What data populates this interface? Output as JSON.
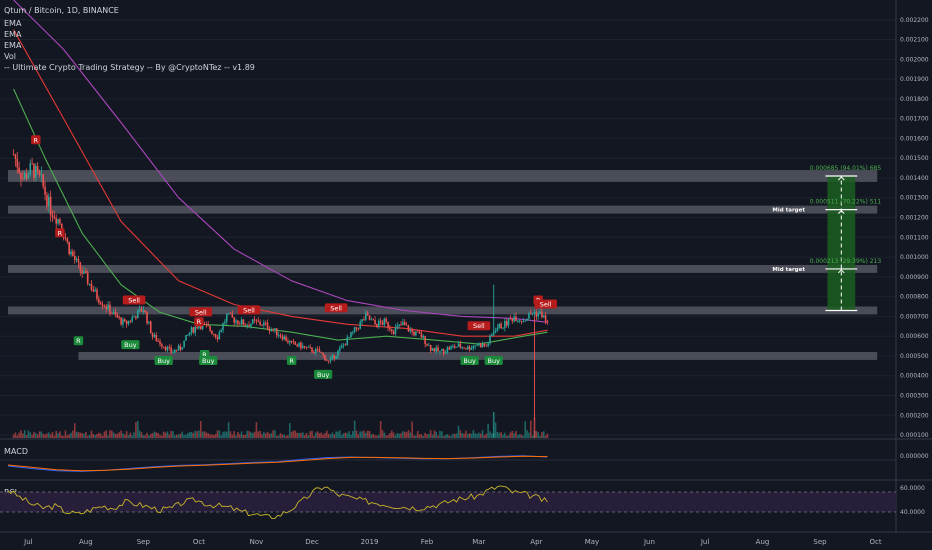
{
  "header": {
    "symbol": "Qtum / Bitcoin, 1D, BINANCE",
    "indicators": [
      "EMA",
      "EMA",
      "EMA",
      "Vol",
      "-- Ultimate Crypto Trading Strategy -- By @CryptoNTez -- v1.89"
    ]
  },
  "colors": {
    "background": "#131722",
    "up": "#26a69a",
    "down": "#ef5350",
    "ema_fast": "#4caf50",
    "ema_mid": "#e53935",
    "ema_slow": "#ab47bc",
    "zone": "#5d606b",
    "target_box": "#1b5e20",
    "rsi_line": "#c9b52a",
    "rsi_band": "#2a1f3d",
    "macd_line": "#2962ff",
    "signal_line": "#ff6d00"
  },
  "chart_data": {
    "type": "candlestick",
    "title": "Qtum / Bitcoin, 1D, BINANCE",
    "ylim": [
      8e-05,
      0.0023
    ],
    "y_ticks": [
      0.0001,
      0.0002,
      0.0003,
      0.0004,
      0.0005,
      0.0006,
      0.0007,
      0.0008,
      0.0009,
      0.001,
      0.0011,
      0.0012,
      0.0013,
      0.0014,
      0.0015,
      0.0016,
      0.0017,
      0.0018,
      0.0019,
      0.002,
      0.0021,
      0.0022
    ],
    "y_tick_labels": [
      "0.000100",
      "0.000200",
      "0.000300",
      "0.000400",
      "0.000500",
      "0.000600",
      "0.000700",
      "0.000800",
      "0.000900",
      "0.001000",
      "0.001100",
      "0.001200",
      "0.001300",
      "0.001400",
      "0.001500",
      "0.001600",
      "0.001700",
      "0.001800",
      "0.001900",
      "0.002000",
      "0.002100",
      "0.002200"
    ],
    "x_labels": [
      "Jul",
      "Aug",
      "Sep",
      "Oct",
      "Nov",
      "Dec",
      "2019",
      "Feb",
      "Mar",
      "Apr",
      "May",
      "Jun",
      "Jul",
      "Aug",
      "Sep",
      "Oct"
    ],
    "price_series": {
      "name": "close",
      "dates": [
        "2018-06-23",
        "2018-06-28",
        "2018-07-03",
        "2018-07-08",
        "2018-07-13",
        "2018-07-18",
        "2018-07-23",
        "2018-07-28",
        "2018-08-02",
        "2018-08-07",
        "2018-08-12",
        "2018-08-17",
        "2018-08-22",
        "2018-08-27",
        "2018-09-01",
        "2018-09-06",
        "2018-09-11",
        "2018-09-16",
        "2018-09-21",
        "2018-09-26",
        "2018-10-01",
        "2018-10-06",
        "2018-10-11",
        "2018-10-16",
        "2018-10-21",
        "2018-10-26",
        "2018-10-31",
        "2018-11-05",
        "2018-11-10",
        "2018-11-15",
        "2018-11-20",
        "2018-11-25",
        "2018-11-30",
        "2018-12-05",
        "2018-12-10",
        "2018-12-15",
        "2018-12-20",
        "2018-12-25",
        "2018-12-30",
        "2019-01-04",
        "2019-01-09",
        "2019-01-14",
        "2019-01-19",
        "2019-01-24",
        "2019-01-29",
        "2019-02-03",
        "2019-02-08",
        "2019-02-13",
        "2019-02-18",
        "2019-02-23",
        "2019-02-28",
        "2019-03-05",
        "2019-03-10",
        "2019-03-15",
        "2019-03-20",
        "2019-03-25",
        "2019-03-30",
        "2019-04-04",
        "2019-04-07"
      ],
      "values": [
        0.00152,
        0.0014,
        0.00145,
        0.00138,
        0.00124,
        0.00118,
        0.00104,
        0.00095,
        0.00088,
        0.0008,
        0.00075,
        0.0007,
        0.00066,
        0.0007,
        0.00074,
        0.0006,
        0.00056,
        0.00052,
        0.00054,
        0.00062,
        0.00066,
        0.00064,
        0.0006,
        0.0007,
        0.00068,
        0.00066,
        0.00067,
        0.00066,
        0.00063,
        0.0006,
        0.00056,
        0.00055,
        0.00053,
        0.00052,
        0.00047,
        0.00052,
        0.00058,
        0.00064,
        0.0007,
        0.00066,
        0.00067,
        0.00063,
        0.00066,
        0.00062,
        0.0006,
        0.00054,
        0.00052,
        0.00054,
        0.00055,
        0.00054,
        0.00056,
        0.00055,
        0.00064,
        0.00066,
        0.0007,
        0.00068,
        0.00072,
        0.00071,
        0.00066
      ]
    },
    "ema_series": [
      {
        "color_key": "ema_fast",
        "dates": [
          "2018-06-23",
          "2018-07-10",
          "2018-07-30",
          "2018-08-20",
          "2018-09-10",
          "2018-10-01",
          "2018-10-25",
          "2018-11-20",
          "2018-12-15",
          "2019-01-10",
          "2019-02-05",
          "2019-03-01",
          "2019-03-25",
          "2019-04-07"
        ],
        "values": [
          0.00185,
          0.0015,
          0.00112,
          0.00086,
          0.00072,
          0.00066,
          0.00065,
          0.00062,
          0.00058,
          0.0006,
          0.00058,
          0.00056,
          0.0006,
          0.00062
        ]
      },
      {
        "color_key": "ema_mid",
        "dates": [
          "2018-06-23",
          "2018-07-20",
          "2018-08-20",
          "2018-09-20",
          "2018-10-20",
          "2018-11-20",
          "2018-12-20",
          "2019-01-20",
          "2019-02-20",
          "2019-03-20",
          "2019-04-07"
        ],
        "values": [
          0.00215,
          0.0017,
          0.00118,
          0.00088,
          0.00076,
          0.0007,
          0.00066,
          0.00064,
          0.0006,
          0.0006,
          0.00063
        ]
      },
      {
        "color_key": "ema_slow",
        "dates": [
          "2018-06-23",
          "2018-07-20",
          "2018-08-20",
          "2018-09-20",
          "2018-10-20",
          "2018-11-20",
          "2018-12-20",
          "2019-01-20",
          "2019-02-20",
          "2019-03-20",
          "2019-04-07"
        ],
        "values": [
          0.0023,
          0.00205,
          0.00168,
          0.0013,
          0.00104,
          0.00088,
          0.00078,
          0.00073,
          0.0007,
          0.00069,
          0.00067
        ]
      }
    ],
    "zones": [
      {
        "low": 0.00138,
        "high": 0.00144
      },
      {
        "low": 0.00122,
        "high": 0.00126
      },
      {
        "low": 0.00092,
        "high": 0.00096
      },
      {
        "low": 0.00071,
        "high": 0.00075
      },
      {
        "low": 0.00048,
        "high": 0.00052
      }
    ],
    "target_box": {
      "date_start": "2019-09-05",
      "date_end": "2019-09-20",
      "entry": 0.00073,
      "levels": [
        {
          "value": 0.00141,
          "label": "0.000685 (94.01%) 685"
        },
        {
          "value": 0.00124,
          "label": "0.000511 (70.22%) 511",
          "zone_label": "Mid target"
        },
        {
          "value": 0.00094,
          "label": "0.000213 (29.39%) 213",
          "zone_label": "Mid target"
        }
      ]
    },
    "signals": [
      {
        "date": "2018-07-05",
        "value": 0.00155,
        "label": "R",
        "kind": "down",
        "pos": "above"
      },
      {
        "date": "2018-07-18",
        "value": 0.00108,
        "label": "R",
        "kind": "down",
        "pos": "above"
      },
      {
        "date": "2018-08-27",
        "value": 0.00074,
        "label": "Sell",
        "kind": "down",
        "pos": "above"
      },
      {
        "date": "2018-08-25",
        "value": 0.0006,
        "label": "Buy",
        "kind": "up",
        "pos": "below"
      },
      {
        "date": "2018-07-28",
        "value": 0.00062,
        "label": "R",
        "kind": "up",
        "pos": "below"
      },
      {
        "date": "2018-09-12",
        "value": 0.00052,
        "label": "Buy",
        "kind": "up",
        "pos": "below"
      },
      {
        "date": "2018-10-02",
        "value": 0.00068,
        "label": "Sell",
        "kind": "down",
        "pos": "above"
      },
      {
        "date": "2018-10-01",
        "value": 0.00063,
        "label": "R",
        "kind": "down",
        "pos": "above"
      },
      {
        "date": "2018-10-04",
        "value": 0.00055,
        "label": "R",
        "kind": "up",
        "pos": "below"
      },
      {
        "date": "2018-10-06",
        "value": 0.00052,
        "label": "Buy",
        "kind": "up",
        "pos": "below"
      },
      {
        "date": "2018-10-28",
        "value": 0.00069,
        "label": "Sell",
        "kind": "down",
        "pos": "above"
      },
      {
        "date": "2018-11-20",
        "value": 0.00052,
        "label": "R",
        "kind": "up",
        "pos": "below"
      },
      {
        "date": "2018-12-07",
        "value": 0.00045,
        "label": "Buy",
        "kind": "up",
        "pos": "below"
      },
      {
        "date": "2018-12-14",
        "value": 0.0007,
        "label": "Sell",
        "kind": "down",
        "pos": "above"
      },
      {
        "date": "2019-02-24",
        "value": 0.00052,
        "label": "Buy",
        "kind": "up",
        "pos": "below"
      },
      {
        "date": "2019-03-01",
        "value": 0.00061,
        "label": "Sell",
        "kind": "down",
        "pos": "above"
      },
      {
        "date": "2019-03-09",
        "value": 0.00052,
        "label": "Buy",
        "kind": "up",
        "pos": "below"
      },
      {
        "date": "2019-04-02",
        "value": 0.00074,
        "label": "R",
        "kind": "down",
        "pos": "above"
      },
      {
        "date": "2019-04-06",
        "value": 0.00072,
        "label": "Sell",
        "kind": "down",
        "pos": "above"
      }
    ],
    "macd": {
      "label": "MACD",
      "y_tick_label": "0.000000",
      "macd_values": [
        -0.5,
        -0.72,
        -0.9,
        -0.95,
        -0.85,
        -0.7,
        -0.55,
        -0.45,
        -0.4,
        -0.3,
        -0.2,
        -0.15,
        0.05,
        0.2,
        0.25,
        0.2,
        0.15,
        0.1,
        0.12,
        0.2,
        0.3,
        0.35,
        0.25
      ],
      "signal_values": [
        -0.42,
        -0.62,
        -0.82,
        -0.9,
        -0.86,
        -0.76,
        -0.62,
        -0.5,
        -0.43,
        -0.35,
        -0.26,
        -0.18,
        -0.04,
        0.12,
        0.22,
        0.22,
        0.18,
        0.13,
        0.12,
        0.17,
        0.25,
        0.31,
        0.28
      ]
    },
    "rsi": {
      "label": "RSI",
      "ylim": [
        30,
        70
      ],
      "upper": 60,
      "lower": 40,
      "tick_labels": [
        "60.0000",
        "40.0000"
      ],
      "values": [
        62,
        55,
        48,
        44,
        46,
        40,
        38,
        42,
        46,
        44,
        50,
        48,
        45,
        42,
        44,
        50,
        52,
        48,
        46,
        44,
        40,
        38,
        35,
        36,
        42,
        50,
        60,
        66,
        58,
        55,
        52,
        50,
        48,
        46,
        45,
        44,
        46,
        48,
        52,
        54,
        56,
        62,
        66,
        60,
        58,
        55,
        50
      ]
    }
  }
}
